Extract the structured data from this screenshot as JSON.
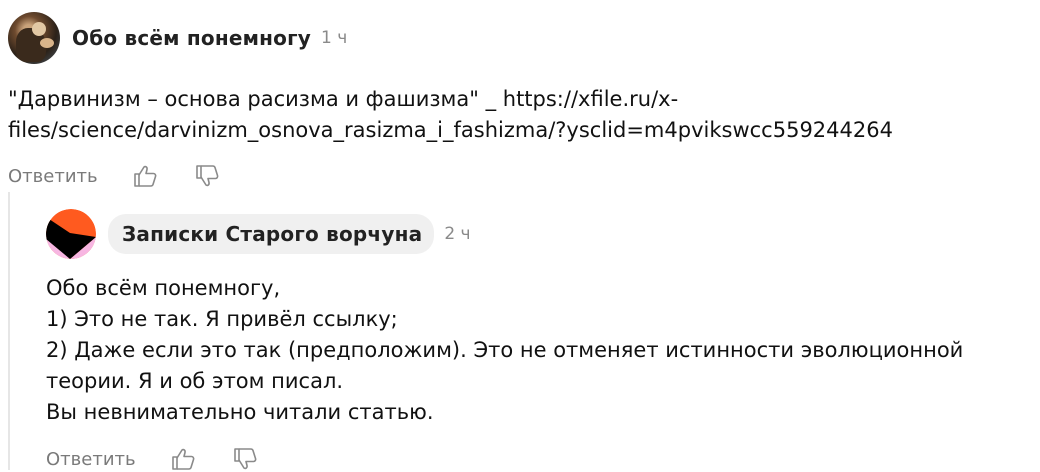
{
  "comments": [
    {
      "author": "Обо всём понемногу",
      "time": "1 ч",
      "lines": [
        "\"Дарвинизм – основа расизма и фашизма\" _ https://xfile.ru/x-",
        "files/science/darvinizm_osnova_rasizma_i_fashizma/?ysclid=m4pvikswcc559244264"
      ],
      "reply_label": "Ответить"
    },
    {
      "author": "Записки Старого ворчуна",
      "time": "2 ч",
      "lines": [
        "Обо всём понемногу,",
        "1) Это не так. Я привёл ссылку;",
        "2) Даже если это так (предположим). Это не отменяет истинности эволюционной",
        "теории. Я и об этом писал.",
        "Вы невнимательно читали статью."
      ],
      "reply_label": "Ответить"
    }
  ],
  "icons": {
    "like": "thumbs-up-icon",
    "dislike": "thumbs-down-icon"
  },
  "colors": {
    "avatar2_orange": "#ff5a1f",
    "avatar2_pink": "#f7b6e2",
    "avatar2_black": "#000000",
    "icon_gray": "#8a8a8a"
  }
}
